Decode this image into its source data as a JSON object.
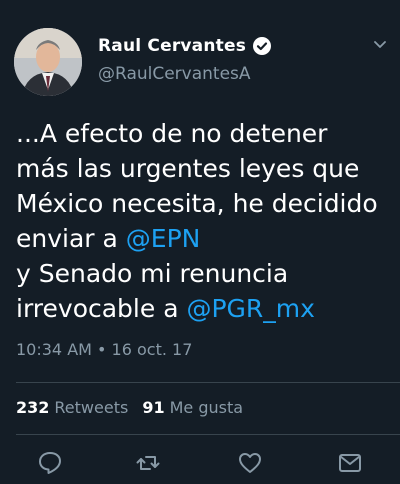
{
  "author": {
    "display_name": "Raul Cervantes",
    "handle": "@RaulCervantesA",
    "verified_icon": "verified-badge-icon",
    "avatar_icon": "avatar"
  },
  "tweet": {
    "text_part1": "...A efecto de no detener más las urgentes leyes que México necesita, he decidido enviar a ",
    "mention1": "@EPN",
    "text_part2": "\ny Senado mi renuncia irrevocable a ",
    "mention2": "@PGR_mx"
  },
  "timestamp": "10:34 AM • 16 oct. 17",
  "stats": {
    "retweets_count": "232",
    "retweets_label": "Retweets",
    "likes_count": "91",
    "likes_label": "Me gusta"
  },
  "actions": {
    "reply_icon": "reply-icon",
    "retweet_icon": "retweet-icon",
    "like_icon": "heart-icon",
    "dm_icon": "message-icon"
  },
  "colors": {
    "background": "#141d26",
    "accent": "#1da1f2",
    "secondary_text": "#8899a6",
    "divider": "#38444d"
  }
}
